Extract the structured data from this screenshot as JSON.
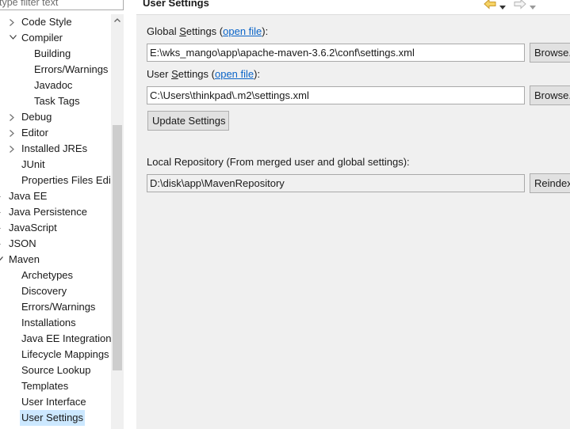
{
  "filter": {
    "placeholder": "type filter text"
  },
  "tree": {
    "items": [
      {
        "label": "Code Style",
        "level": 1,
        "twisty": "collapsed"
      },
      {
        "label": "Compiler",
        "level": 1,
        "twisty": "expanded"
      },
      {
        "label": "Building",
        "level": 2,
        "twisty": "none"
      },
      {
        "label": "Errors/Warnings",
        "level": 2,
        "twisty": "none"
      },
      {
        "label": "Javadoc",
        "level": 2,
        "twisty": "none"
      },
      {
        "label": "Task Tags",
        "level": 2,
        "twisty": "none"
      },
      {
        "label": "Debug",
        "level": 1,
        "twisty": "collapsed"
      },
      {
        "label": "Editor",
        "level": 1,
        "twisty": "collapsed"
      },
      {
        "label": "Installed JREs",
        "level": 1,
        "twisty": "collapsed"
      },
      {
        "label": "JUnit",
        "level": 1,
        "twisty": "none"
      },
      {
        "label": "Properties Files Edi",
        "level": 1,
        "twisty": "none"
      },
      {
        "label": "Java EE",
        "level": 0,
        "twisty": "collapsed"
      },
      {
        "label": "Java Persistence",
        "level": 0,
        "twisty": "collapsed"
      },
      {
        "label": "JavaScript",
        "level": 0,
        "twisty": "collapsed"
      },
      {
        "label": "JSON",
        "level": 0,
        "twisty": "collapsed"
      },
      {
        "label": "Maven",
        "level": 0,
        "twisty": "expanded"
      },
      {
        "label": "Archetypes",
        "level": 1,
        "twisty": "none"
      },
      {
        "label": "Discovery",
        "level": 1,
        "twisty": "none"
      },
      {
        "label": "Errors/Warnings",
        "level": 1,
        "twisty": "none"
      },
      {
        "label": "Installations",
        "level": 1,
        "twisty": "none"
      },
      {
        "label": "Java EE Integration",
        "level": 1,
        "twisty": "none"
      },
      {
        "label": "Lifecycle Mappings",
        "level": 1,
        "twisty": "none"
      },
      {
        "label": "Source Lookup",
        "level": 1,
        "twisty": "none"
      },
      {
        "label": "Templates",
        "level": 1,
        "twisty": "none"
      },
      {
        "label": "User Interface",
        "level": 1,
        "twisty": "none"
      },
      {
        "label": "User Settings",
        "level": 1,
        "twisty": "none",
        "selected": true
      }
    ]
  },
  "page": {
    "title": "User Settings",
    "global": {
      "label_prefix": "Global ",
      "label_mnemonic": "S",
      "label_rest": "ettings (",
      "link": "open file",
      "label_suffix": "):",
      "value": "E:\\wks_mango\\app\\apache-maven-3.6.2\\conf\\settings.xml",
      "browse_label": "Browse..."
    },
    "user": {
      "label_prefix": "User ",
      "label_mnemonic": "S",
      "label_rest": "ettings (",
      "link": "open file",
      "label_suffix": "):",
      "value": "C:\\Users\\thinkpad\\.m2\\settings.xml",
      "browse_label": "Browse..."
    },
    "update_label": "Update Settings",
    "local_repo": {
      "label": "Local Repository (From merged user and global settings):",
      "value": "D:\\disk\\app\\MavenRepository",
      "reindex_label": "Reindex"
    }
  },
  "colors": {
    "selection": "#cce8ff",
    "link": "#0a64c8",
    "back_arrow": "#e8b84a",
    "panel_bg": "#f0f0f0"
  }
}
